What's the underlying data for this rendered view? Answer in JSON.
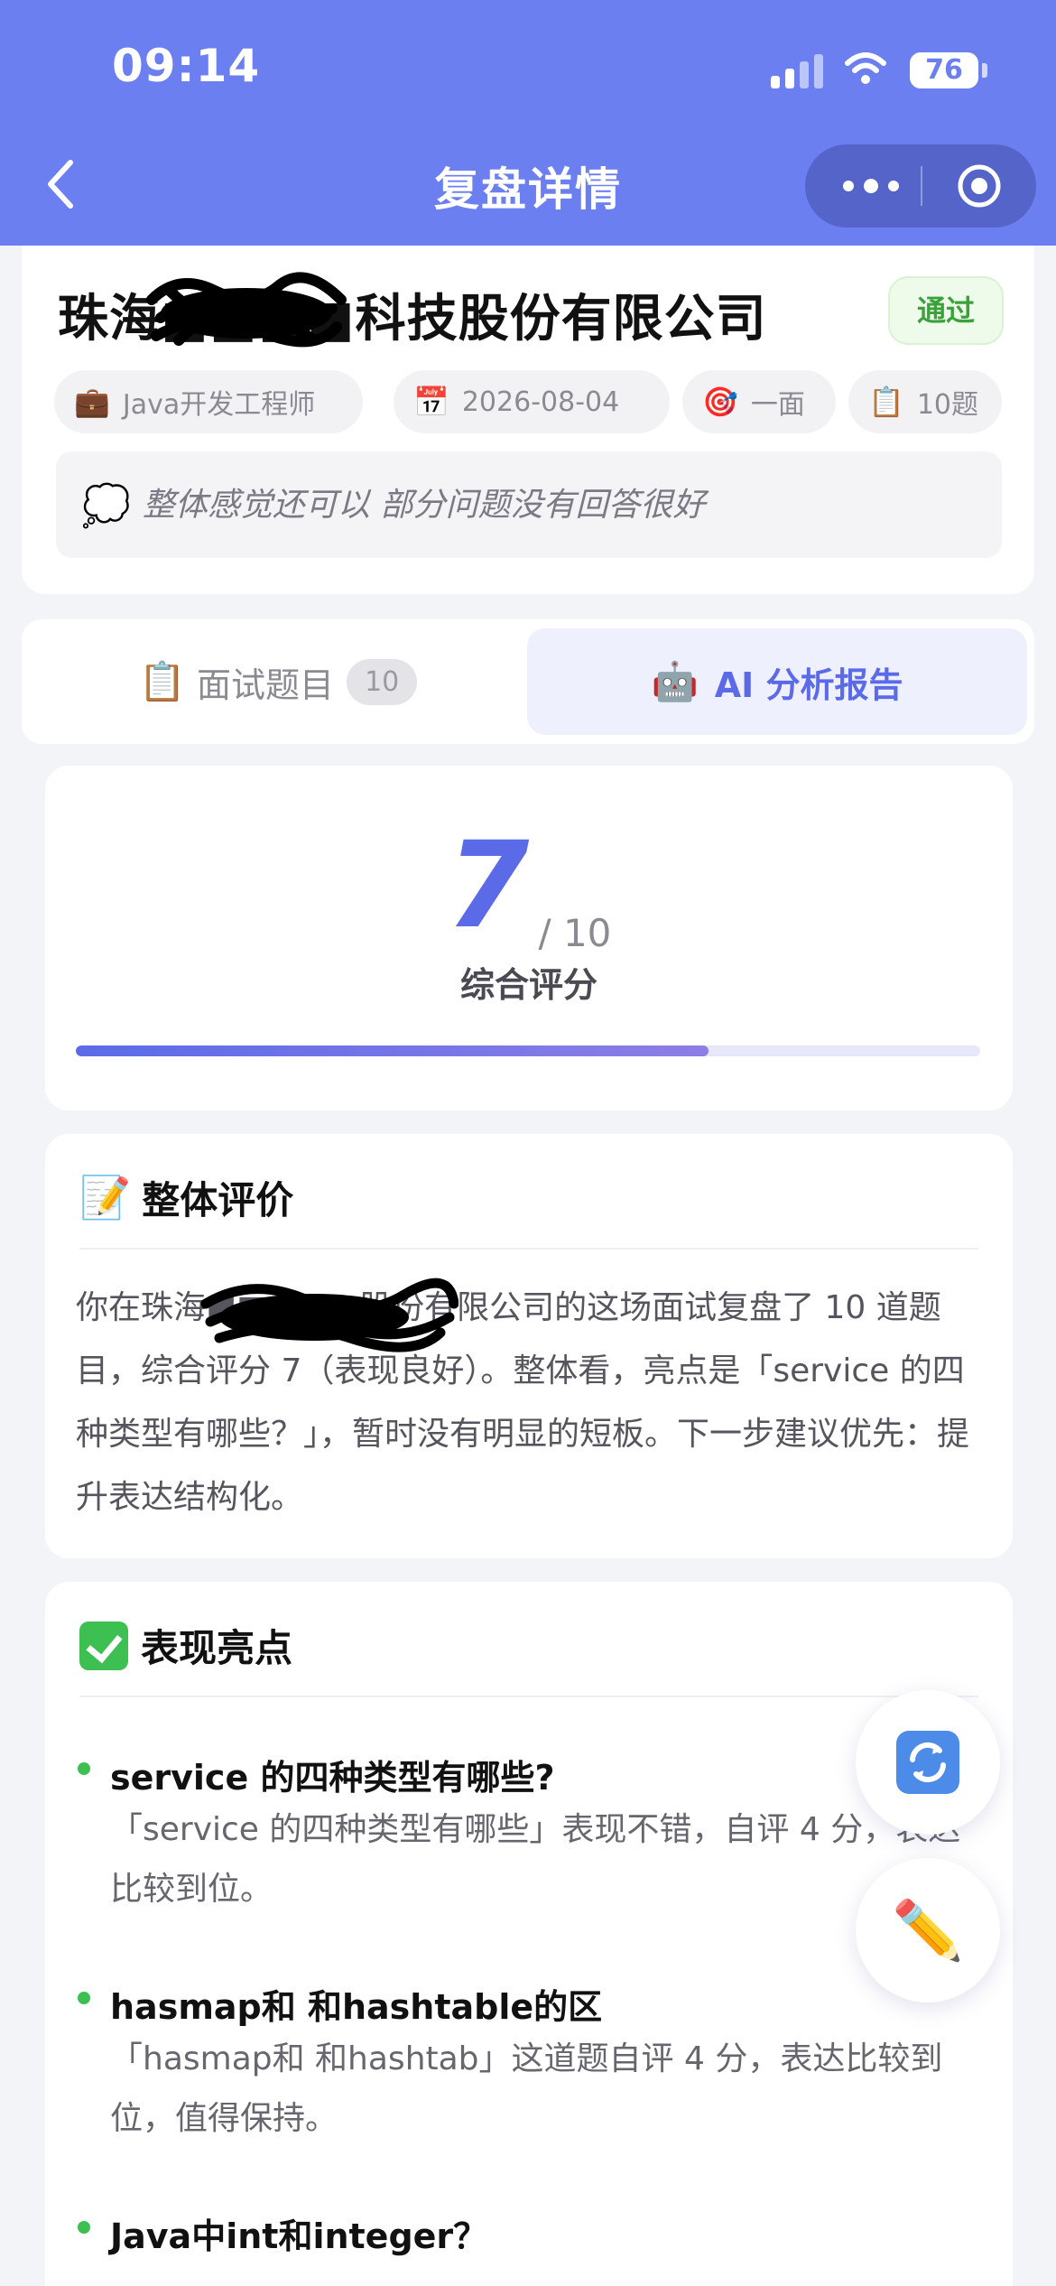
{
  "status_bar": {
    "time": "09:14",
    "battery": "76"
  },
  "nav": {
    "title": "复盘详情"
  },
  "company": {
    "name": "珠海■■■■科技股份有限公司",
    "status": "通过",
    "tags": [
      {
        "icon": "💼",
        "label": "Java开发工程师"
      },
      {
        "icon": "📅",
        "label": "2026-08-04"
      },
      {
        "icon": "🎯",
        "label": "一面"
      },
      {
        "icon": "📋",
        "label": "10题"
      }
    ],
    "note": "整体感觉还可以 部分问题没有回答很好"
  },
  "tabs": {
    "questions_label": "面试题目",
    "questions_count": "10",
    "ai_label": "AI 分析报告"
  },
  "score": {
    "value": "7",
    "max": "/ 10",
    "label": "综合评分",
    "progress_fraction": 0.7
  },
  "evaluation": {
    "title": "整体评价",
    "text": "你在珠海■■■■■股份有限公司的这场面试复盘了 10 道题目，综合评分 7（表现良好）。整体看，亮点是「service 的四种类型有哪些？」，暂时没有明显的短板。下一步建议优先：提升表达结构化。"
  },
  "highlights": {
    "title": "表现亮点",
    "items": [
      {
        "title": "service 的四种类型有哪些?",
        "desc": "「service 的四种类型有哪些」表现不错，自评 4 分，表达比较到位。"
      },
      {
        "title": "hasmap和 和hashtable的区",
        "desc": "「hasmap和 和hashtab」这道题自评 4 分，表达比较到位，值得保持。"
      },
      {
        "title": "Java中int和integer？",
        "desc": ""
      }
    ]
  }
}
